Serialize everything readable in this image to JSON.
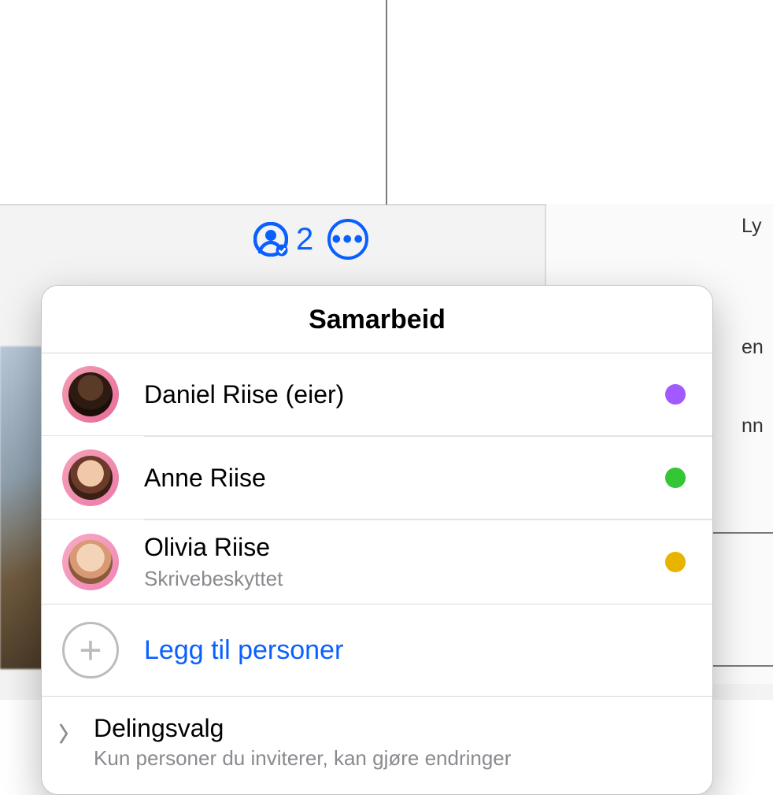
{
  "toolbar": {
    "collaborator_count": "2",
    "right_panel_tab": "Ly",
    "right_panel_frag1": "en",
    "right_panel_frag2": "nn"
  },
  "popup": {
    "title": "Samarbeid",
    "people": [
      {
        "name": "Daniel Riise (eier)",
        "sub": "",
        "dot": "#a259ff"
      },
      {
        "name": "Anne Riise",
        "sub": "",
        "dot": "#34c634"
      },
      {
        "name": "Olivia Riise",
        "sub": "Skrivebeskyttet",
        "dot": "#e8b400"
      }
    ],
    "add_label": "Legg til personer",
    "options_title": "Delingsvalg",
    "options_sub": "Kun personer du inviterer, kan gjøre endringer"
  }
}
